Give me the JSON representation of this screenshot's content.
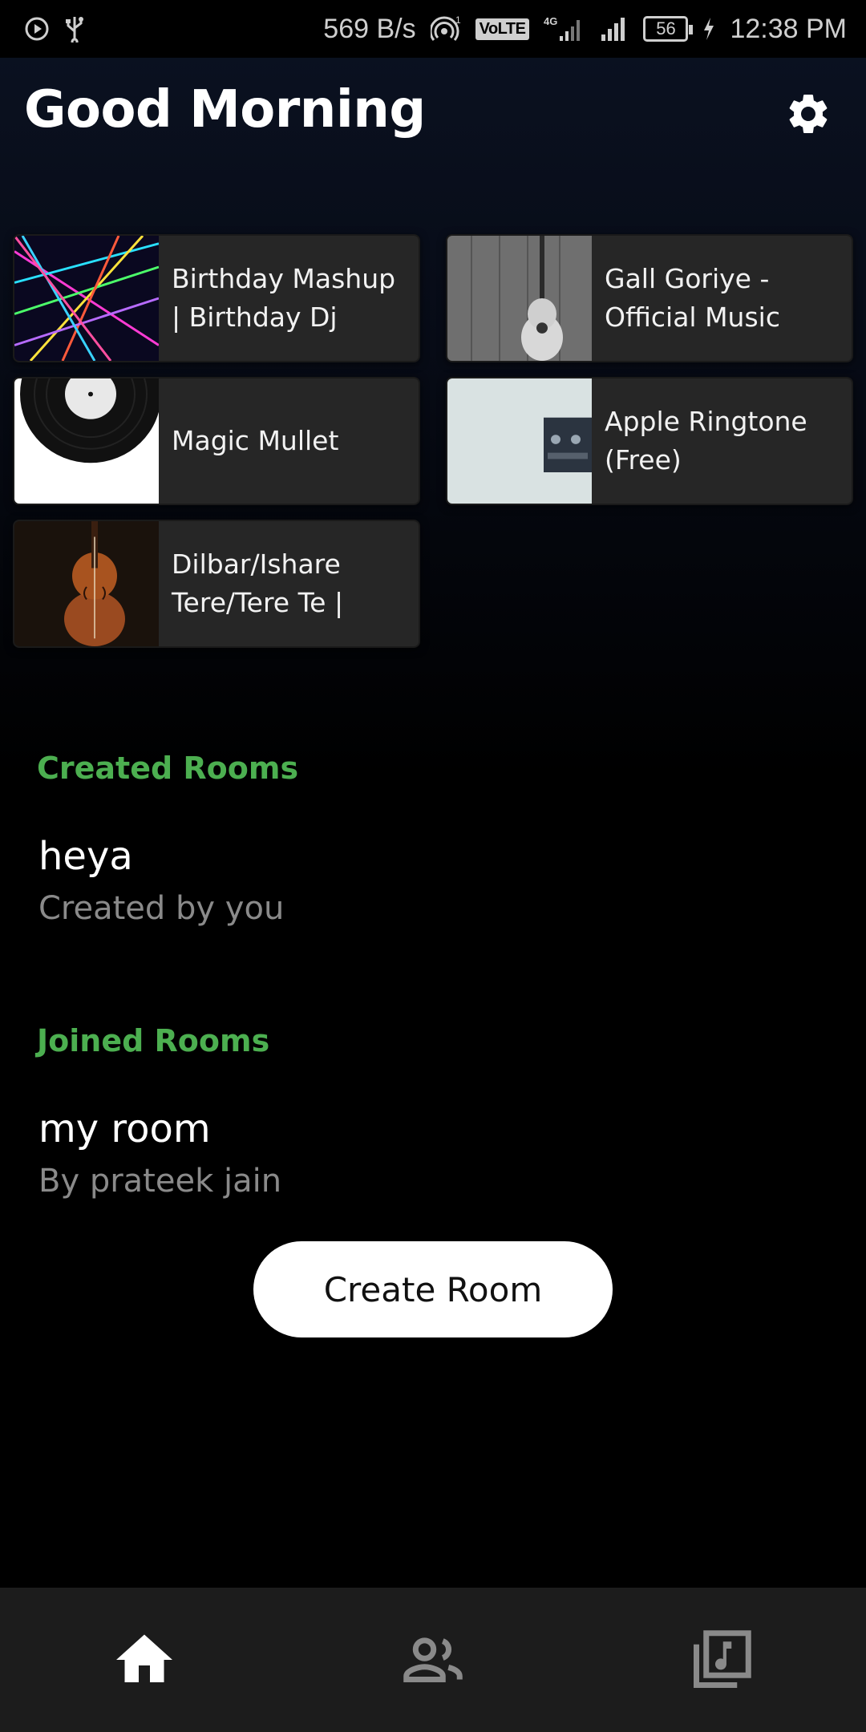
{
  "status_bar": {
    "network_speed": "569 B/s",
    "volte": "VoLTE",
    "network_type": "4G",
    "battery": "56",
    "time": "12:38 PM",
    "icons": [
      "play-icon",
      "usb-icon",
      "hotspot-icon",
      "signal-icon",
      "charging-icon"
    ]
  },
  "header": {
    "greeting": "Good Morning",
    "settings_icon": "gear-icon"
  },
  "recent_songs": [
    {
      "title": "Birthday Mashup | Birthday Dj",
      "thumb": "laser-lights"
    },
    {
      "title": "Gall Goriye - Official Music",
      "thumb": "guitar-on-wall"
    },
    {
      "title": "Magic Mullet",
      "thumb": "vinyl-record"
    },
    {
      "title": "Apple Ringtone (Free)",
      "thumb": "cassette-tape"
    },
    {
      "title": "Dilbar/Ishare Tere/Tere Te |",
      "thumb": "violin"
    }
  ],
  "created_rooms": {
    "heading": "Created Rooms",
    "rooms": [
      {
        "name": "heya",
        "subtitle": "Created by you"
      }
    ]
  },
  "joined_rooms": {
    "heading": "Joined Rooms",
    "rooms": [
      {
        "name": "my room",
        "subtitle": "By prateek jain"
      }
    ]
  },
  "create_room_button": "Create Room",
  "bottom_nav": {
    "items": [
      {
        "icon": "home-icon",
        "active": true
      },
      {
        "icon": "people-icon",
        "active": false
      },
      {
        "icon": "music-library-icon",
        "active": false
      }
    ],
    "active_color": "#ffffff",
    "inactive_color": "#8a8a8a"
  },
  "colors": {
    "accent_green": "#4caf50",
    "card_bg": "#262626",
    "background": "#000000"
  }
}
